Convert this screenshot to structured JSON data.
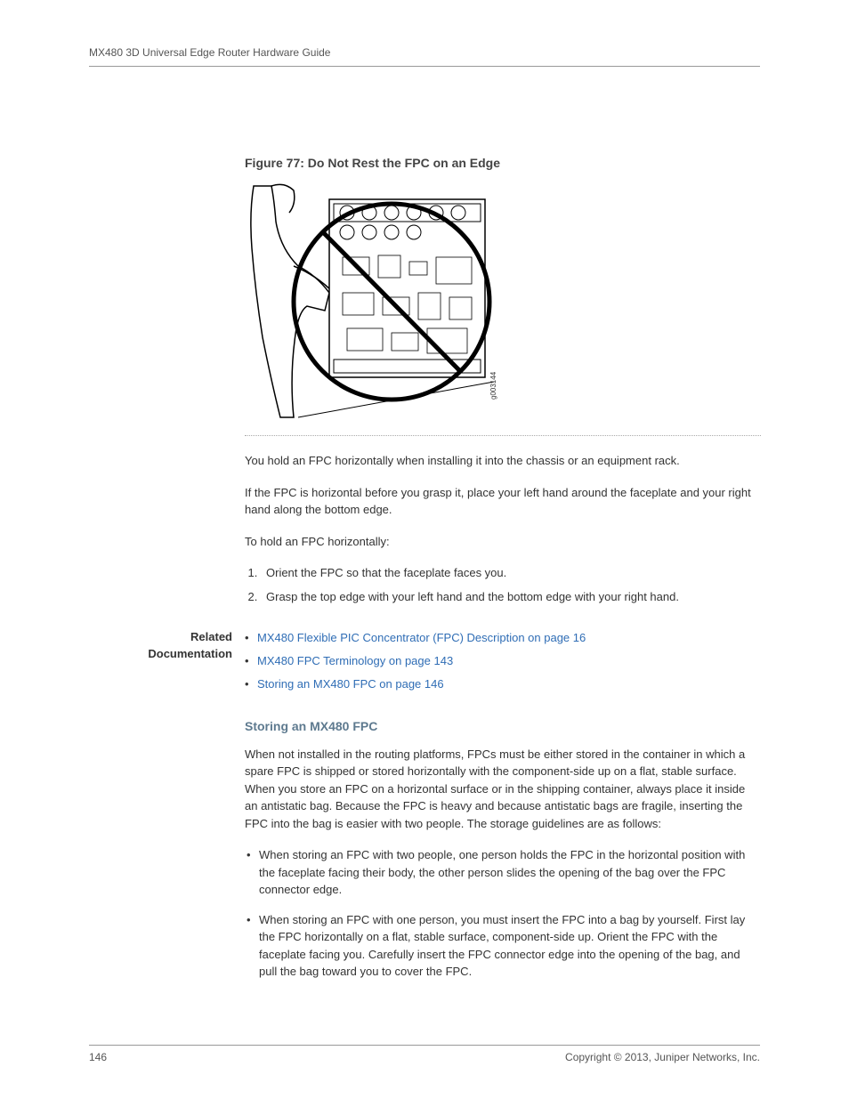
{
  "header": {
    "title": "MX480 3D Universal Edge Router Hardware Guide"
  },
  "figure": {
    "caption": "Figure 77: Do Not Rest the FPC on an Edge",
    "image_id": "g003144"
  },
  "paragraphs": {
    "p1": "You hold an FPC horizontally when installing it into the chassis or an equipment rack.",
    "p2": "If the FPC is horizontal before you grasp it, place your left hand around the faceplate and your right hand along the bottom edge.",
    "p3": "To hold an FPC horizontally:"
  },
  "steps": [
    "Orient the FPC so that the faceplate faces you.",
    "Grasp the top edge with your left hand and the bottom edge with your right hand."
  ],
  "related": {
    "label_line1": "Related",
    "label_line2": "Documentation",
    "items": [
      {
        "link": "MX480 Flexible PIC Concentrator (FPC) Description on page 16"
      },
      {
        "link": "MX480 FPC Terminology on page 143"
      },
      {
        "link": "Storing an MX480 FPC on page 146"
      }
    ]
  },
  "section": {
    "heading": "Storing an MX480 FPC",
    "intro": "When not installed in the routing platforms, FPCs must be either stored in the container in which a spare FPC is shipped or stored horizontally with the component-side up on a flat, stable surface. When you store an FPC on a horizontal surface or in the shipping container, always place it inside an antistatic bag. Because the FPC is heavy and because antistatic bags are fragile, inserting the FPC into the bag is easier with two people. The storage guidelines are as follows:",
    "bullets": [
      "When storing an FPC with two people, one person holds the FPC in the horizontal position with the faceplate facing their body, the other person slides the opening of the bag over the FPC connector edge.",
      "When storing an FPC with one person, you must insert the FPC into a bag by yourself. First lay the FPC horizontally on a flat, stable surface, component-side up. Orient the FPC with the faceplate facing you. Carefully insert the FPC connector edge into the opening of the bag, and pull the bag toward you to cover the FPC."
    ]
  },
  "footer": {
    "page": "146",
    "copyright": "Copyright © 2013, Juniper Networks, Inc."
  }
}
